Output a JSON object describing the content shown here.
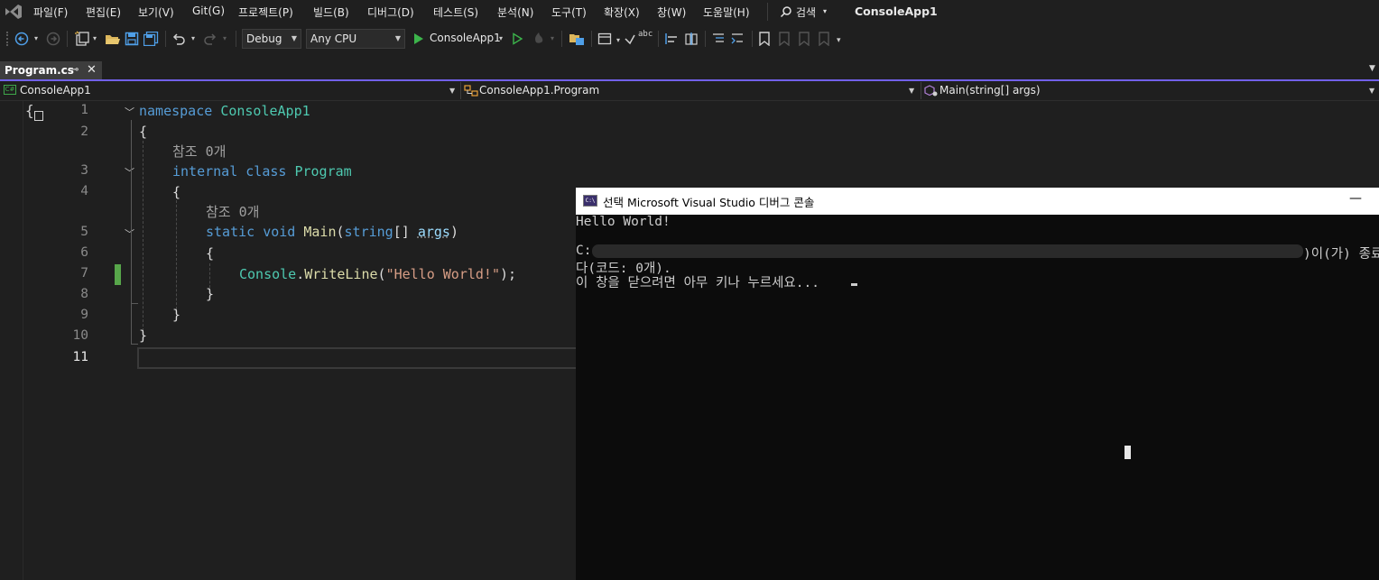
{
  "menu": {
    "items": [
      "파일(F)",
      "편집(E)",
      "보기(V)",
      "Git(G)",
      "프로젝트(P)",
      "빌드(B)",
      "디버그(D)",
      "테스트(S)",
      "분석(N)",
      "도구(T)",
      "확장(X)",
      "창(W)",
      "도움말(H)"
    ],
    "search_label": "검색",
    "app_title": "ConsoleApp1"
  },
  "toolbar": {
    "configuration": "Debug",
    "platform": "Any CPU",
    "start_target": "ConsoleApp1"
  },
  "tabs": [
    {
      "label": "Program.cs",
      "active": true
    }
  ],
  "navbar": {
    "project": "ConsoleApp1",
    "type": "ConsoleApp1.Program",
    "member": "Main(string[] args)"
  },
  "editor": {
    "line_numbers": [
      "1",
      "2",
      "3",
      "4",
      "5",
      "6",
      "7",
      "8",
      "9",
      "10",
      "11"
    ],
    "codelens_label": "참조 0개",
    "lines": {
      "l1_kw": "namespace",
      "l1_name": "ConsoleApp1",
      "l2": "{",
      "l3_kw1": "internal",
      "l3_kw2": "class",
      "l3_name": "Program",
      "l4": "{",
      "l5_kw1": "static",
      "l5_kw2": "void",
      "l5_method": "Main",
      "l5_p1": "(",
      "l5_type": "string",
      "l5_p2": "[] ",
      "l5_param": "args",
      "l5_p3": ")",
      "l6": "{",
      "l7_type": "Console",
      "l7_dot": ".",
      "l7_method": "WriteLine",
      "l7_p1": "(",
      "l7_str": "\"Hello World!\"",
      "l7_p2": ");",
      "l8": "}",
      "l9": "}",
      "l10": "}"
    }
  },
  "console": {
    "title": "선택 Microsoft Visual Studio 디버그 콘솔",
    "icon_text": "C:\\",
    "lines": {
      "hello": "Hello World!",
      "path_start": "C:",
      "exit_end": ")이(가) 종료",
      "exit_code": "다(코드: 0개).",
      "press_key": "이 창을 닫으려면 아무 키나 누르세요..."
    }
  },
  "colors": {
    "accent": "#7160e8",
    "editor_bg": "#1f1f1f",
    "keyword": "#569cd6",
    "type": "#4ec9b0",
    "string": "#d69d85",
    "method": "#dcdcaa",
    "change_marker": "#57a64a"
  }
}
